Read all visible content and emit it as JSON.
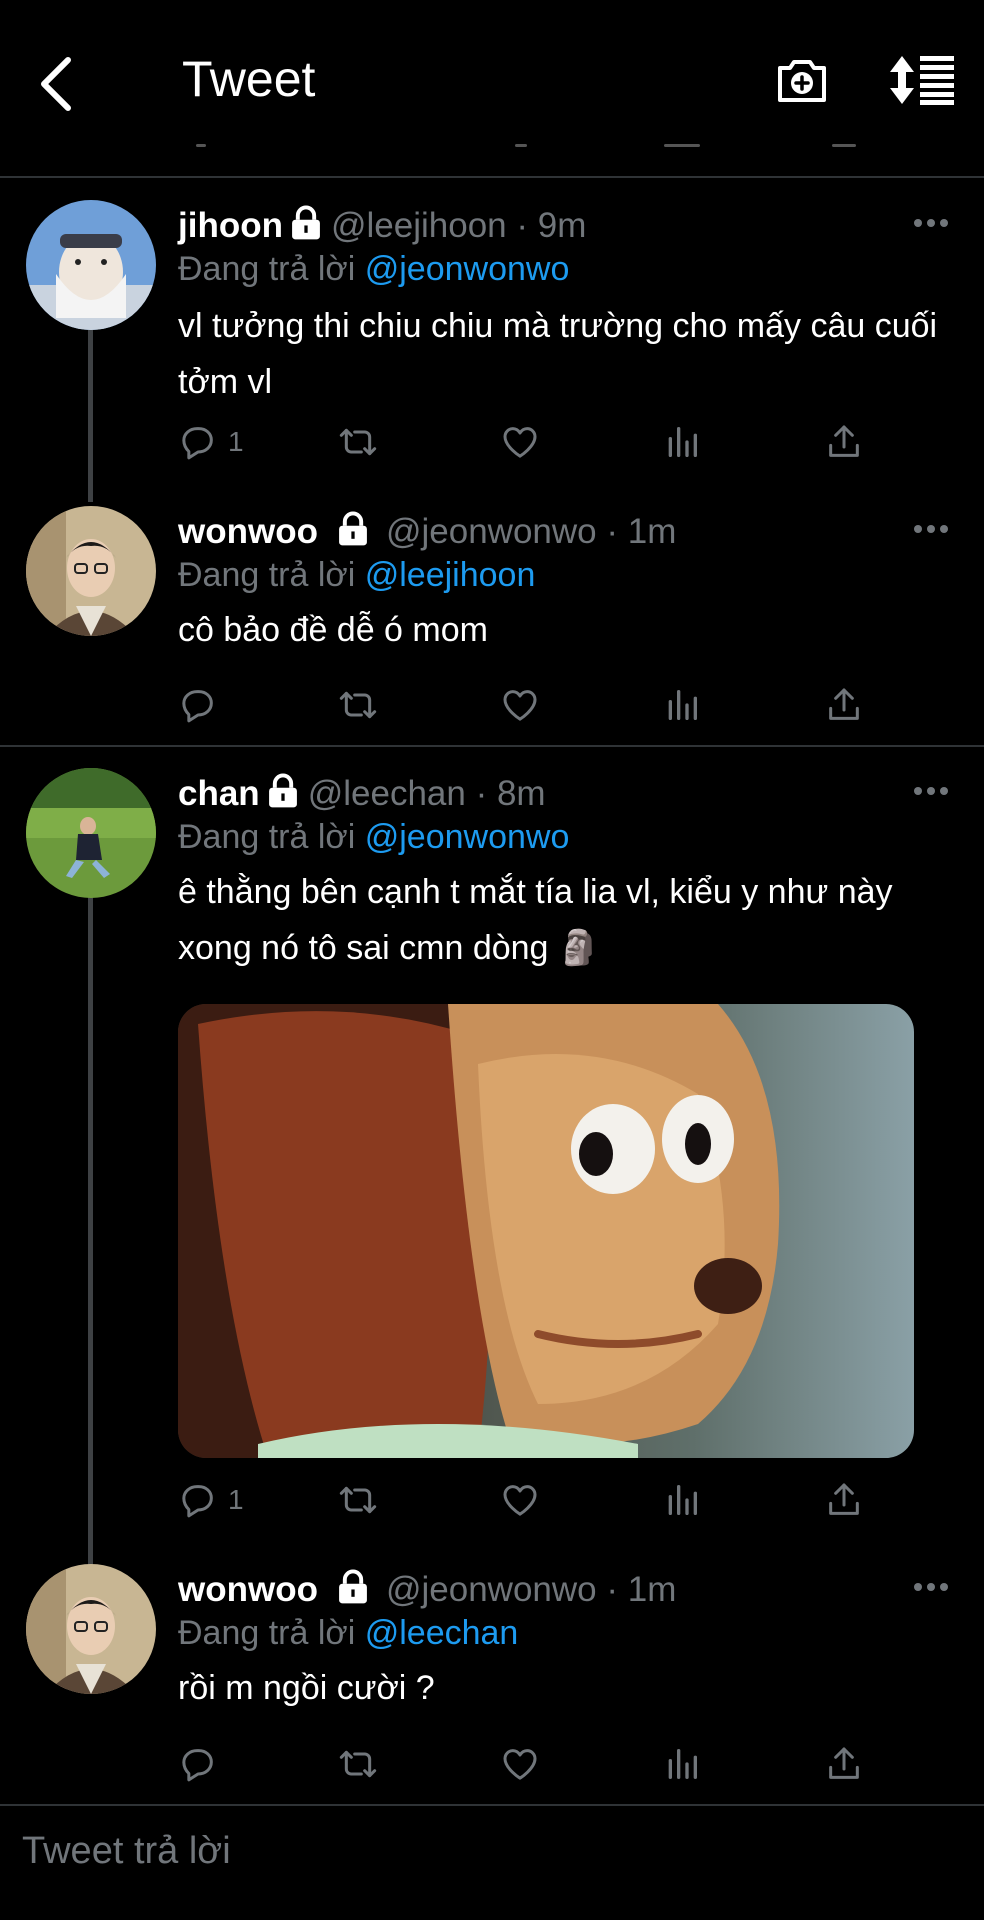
{
  "header": {
    "title": "Tweet"
  },
  "tweets": [
    {
      "name": "jihoon",
      "handle": "@leejihoon",
      "dot": "·",
      "time": "9m",
      "reply_prefix": "Đang trả lời",
      "reply_mention": "@jeonwonwo",
      "text": "vl tưởng thi chiu chiu mà trường cho mấy câu cuối tởm vl",
      "reply_count": "1"
    },
    {
      "name": "wonwoo",
      "handle": "@jeonwonwo",
      "dot": "·",
      "time": "1m",
      "reply_prefix": "Đang trả lời",
      "reply_mention": "@leejihoon",
      "text": "cô bảo đề dễ ó mom",
      "reply_count": ""
    },
    {
      "name": "chan",
      "handle": "@leechan",
      "dot": "·",
      "time": "8m",
      "reply_prefix": "Đang trả lời",
      "reply_mention": "@jeonwonwo",
      "text": "ê thằng bên cạnh t mắt tía lia vl, kiểu y như này xong nó tô sai cmn dòng 🗿",
      "reply_count": "1"
    },
    {
      "name": "wonwoo",
      "handle": "@jeonwonwo",
      "dot": "·",
      "time": "1m",
      "reply_prefix": "Đang trả lời",
      "reply_mention": "@leechan",
      "text": "rồi m ngồi cười ?",
      "reply_count": ""
    }
  ],
  "compose": {
    "placeholder": "Tweet trả lời"
  },
  "colors": {
    "background": "#000000",
    "accent": "#1d9bf0",
    "muted": "#71767b",
    "divider": "#2f3336"
  },
  "icons": [
    "back-arrow-icon",
    "camera-plus-icon",
    "sort-icon",
    "lock-icon",
    "more-icon",
    "reply-icon",
    "retweet-icon",
    "like-icon",
    "analytics-icon",
    "share-icon"
  ]
}
